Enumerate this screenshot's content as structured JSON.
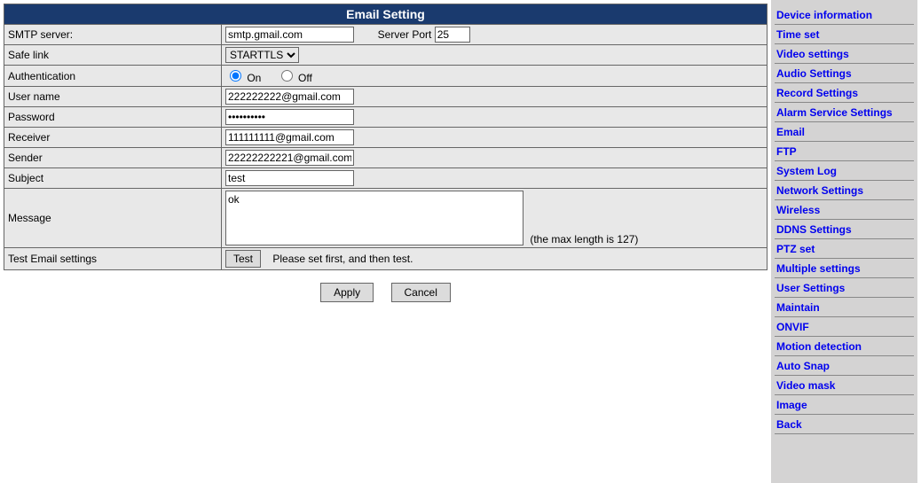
{
  "title": "Email Setting",
  "fields": {
    "smtp_label": "SMTP server:",
    "smtp_value": "smtp.gmail.com",
    "port_label": "Server Port",
    "port_value": "25",
    "safelink_label": "Safe link",
    "safelink_value": "STARTTLS",
    "auth_label": "Authentication",
    "auth_on": "On",
    "auth_off": "Off",
    "username_label": "User name",
    "username_value": "222222222@gmail.com",
    "password_label": "Password",
    "password_value": "••••••••••",
    "receiver_label": "Receiver",
    "receiver_value": "111111111@gmail.com",
    "sender_label": "Sender",
    "sender_value": "22222222221@gmail.com",
    "subject_label": "Subject",
    "subject_value": "test",
    "message_label": "Message",
    "message_value": "ok",
    "message_hint": "(the max length is 127)",
    "test_label": "Test Email settings",
    "test_button": "Test",
    "test_hint": "Please set first, and then test."
  },
  "buttons": {
    "apply": "Apply",
    "cancel": "Cancel"
  },
  "sidebar": [
    "Device information",
    "Time set",
    "Video settings",
    "Audio Settings",
    "Record Settings",
    "Alarm Service Settings",
    "Email",
    "FTP",
    "System Log",
    "Network Settings",
    "Wireless",
    "DDNS Settings",
    "PTZ set",
    "Multiple settings",
    "User Settings",
    "Maintain",
    "ONVIF",
    "Motion detection",
    "Auto Snap",
    "Video mask",
    "Image",
    "Back"
  ]
}
